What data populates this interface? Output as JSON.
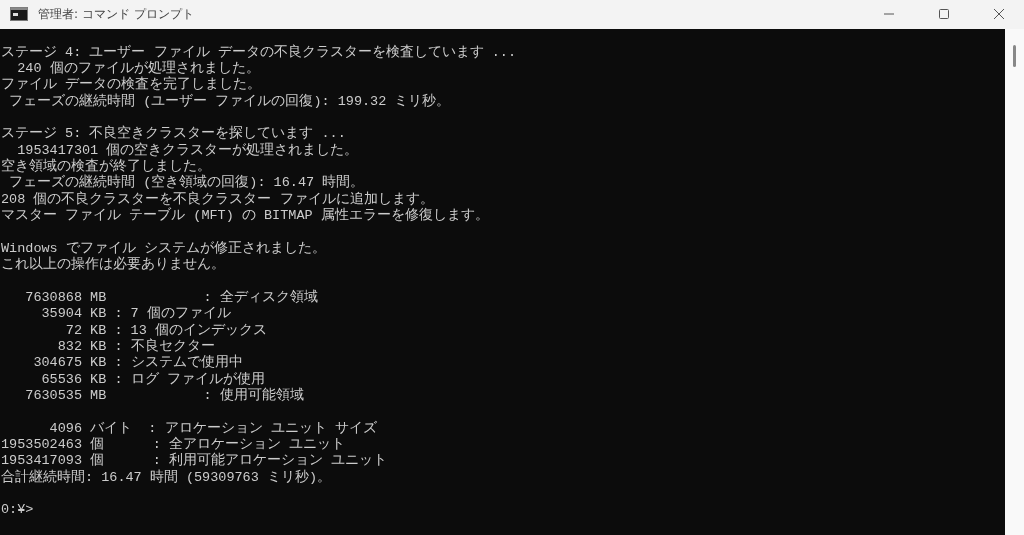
{
  "window": {
    "title": "管理者: コマンド プロンプト"
  },
  "console": {
    "blocks": [
      [
        "ステージ 4: ユーザー ファイル データの不良クラスターを検査しています ...",
        "  240 個のファイルが処理されました。",
        "ファイル データの検査を完了しました。",
        " フェーズの継続時間 (ユーザー ファイルの回復): 199.32 ミリ秒。"
      ],
      [
        "ステージ 5: 不良空きクラスターを探しています ...",
        "  1953417301 個の空きクラスターが処理されました。",
        "空き領域の検査が終了しました。",
        " フェーズの継続時間 (空き領域の回復): 16.47 時間。",
        "208 個の不良クラスターを不良クラスター ファイルに追加します。",
        "マスター ファイル テーブル (MFT) の BITMAP 属性エラーを修復します。"
      ],
      [
        "Windows でファイル システムが修正されました。",
        "これ以上の操作は必要ありません。"
      ],
      [
        "   7630868 MB            : 全ディスク領域",
        "     35904 KB : 7 個のファイル",
        "        72 KB : 13 個のインデックス",
        "       832 KB : 不良セクター",
        "    304675 KB : システムで使用中",
        "     65536 KB : ログ ファイルが使用",
        "   7630535 MB            : 使用可能領域"
      ],
      [
        "      4096 バイト  : アロケーション ユニット サイズ",
        "1953502463 個      : 全アロケーション ユニット",
        "1953417093 個      : 利用可能アロケーション ユニット",
        "合計継続時間: 16.47 時間 (59309763 ミリ秒)。"
      ],
      [
        "0:¥>"
      ]
    ]
  }
}
